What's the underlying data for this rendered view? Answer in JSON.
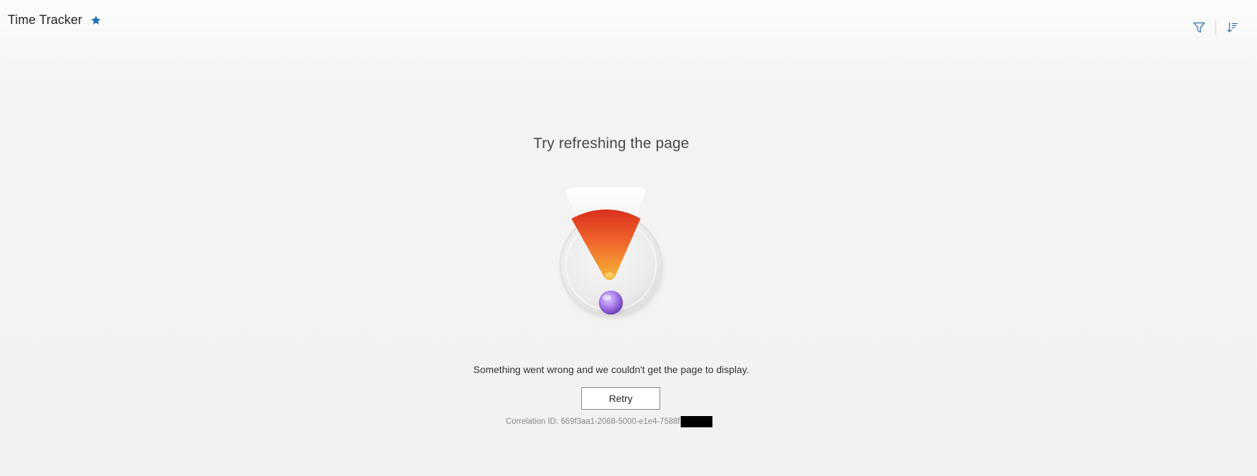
{
  "header": {
    "title": "Time Tracker",
    "favorite_icon": "star-icon",
    "favorite_color": "#1f6fb2",
    "toolbar": {
      "filter_icon": "filter-icon",
      "sort_icon": "sort-icon",
      "icon_color": "#2b6cb0"
    }
  },
  "error": {
    "title": "Try refreshing the page",
    "illustration": "exclamation-illustration",
    "message": "Something went wrong and we couldn't get the page to display.",
    "retry_label": "Retry",
    "correlation_label": "Correlation ID:",
    "correlation_id": "669f3aa1-2068-5000-e1e4-7588f"
  }
}
